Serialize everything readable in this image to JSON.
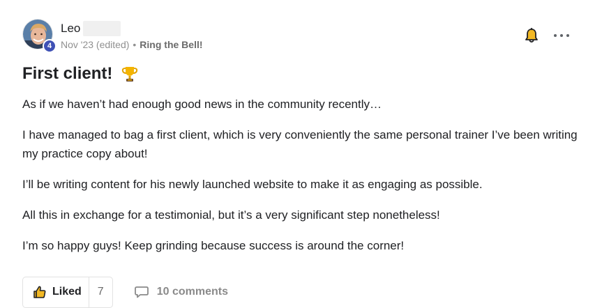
{
  "post": {
    "author": {
      "name": "Leo",
      "level": "4"
    },
    "meta": {
      "date": "Nov '23 (edited)",
      "separator": "•",
      "category": "Ring the Bell!"
    },
    "title": "First client!",
    "title_emoji": "trophy-icon",
    "paragraphs": [
      "As if we haven’t had enough good news in the community recently…",
      "I have managed to bag a first client, which is very conveniently the same personal trainer I’ve been writing my practice copy about!",
      "I’ll be writing content for his newly launched website to make it as engaging as possible.",
      "All this in exchange for a testimonial, but it’s a very significant step nonetheless!",
      "I’m so happy guys! Keep grinding because success is around the corner!"
    ],
    "actions": {
      "like_label": "Liked",
      "like_count": "7",
      "comments_label": "10 comments"
    }
  },
  "colors": {
    "badge": "#3f51b5",
    "bell": "#f2b824",
    "text": "#202124",
    "muted": "#909090"
  }
}
